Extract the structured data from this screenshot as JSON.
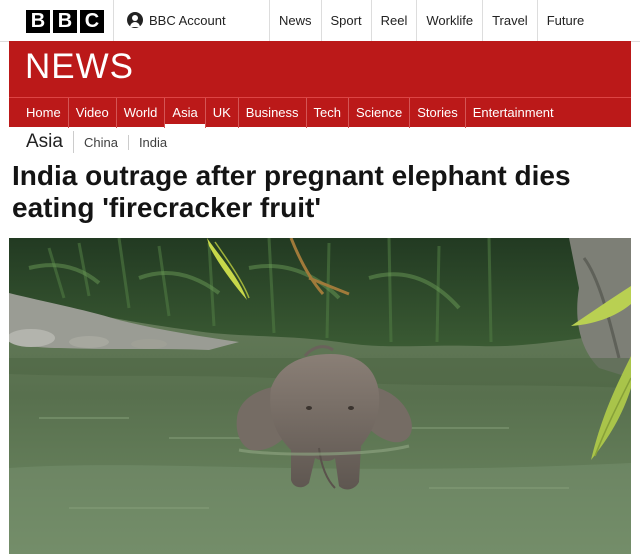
{
  "brand": {
    "letters": [
      "B",
      "B",
      "C"
    ],
    "section_title": "NEWS"
  },
  "account": {
    "label": "BBC Account",
    "icon": "user-icon"
  },
  "top_nav": [
    "News",
    "Sport",
    "Reel",
    "Worklife",
    "Travel",
    "Future"
  ],
  "main_nav": {
    "items": [
      "Home",
      "Video",
      "World",
      "Asia",
      "UK",
      "Business",
      "Tech",
      "Science",
      "Stories",
      "Entertainment"
    ],
    "active": "Asia"
  },
  "sub_nav": {
    "section": "Asia",
    "items": [
      "China",
      "India"
    ]
  },
  "article": {
    "headline": "India outrage after pregnant elephant dies eating 'firecracker fruit'"
  },
  "colors": {
    "brand_red": "#bb1919",
    "text": "#141414",
    "water": "#5b7050",
    "foliage": "#2f4a2a"
  }
}
